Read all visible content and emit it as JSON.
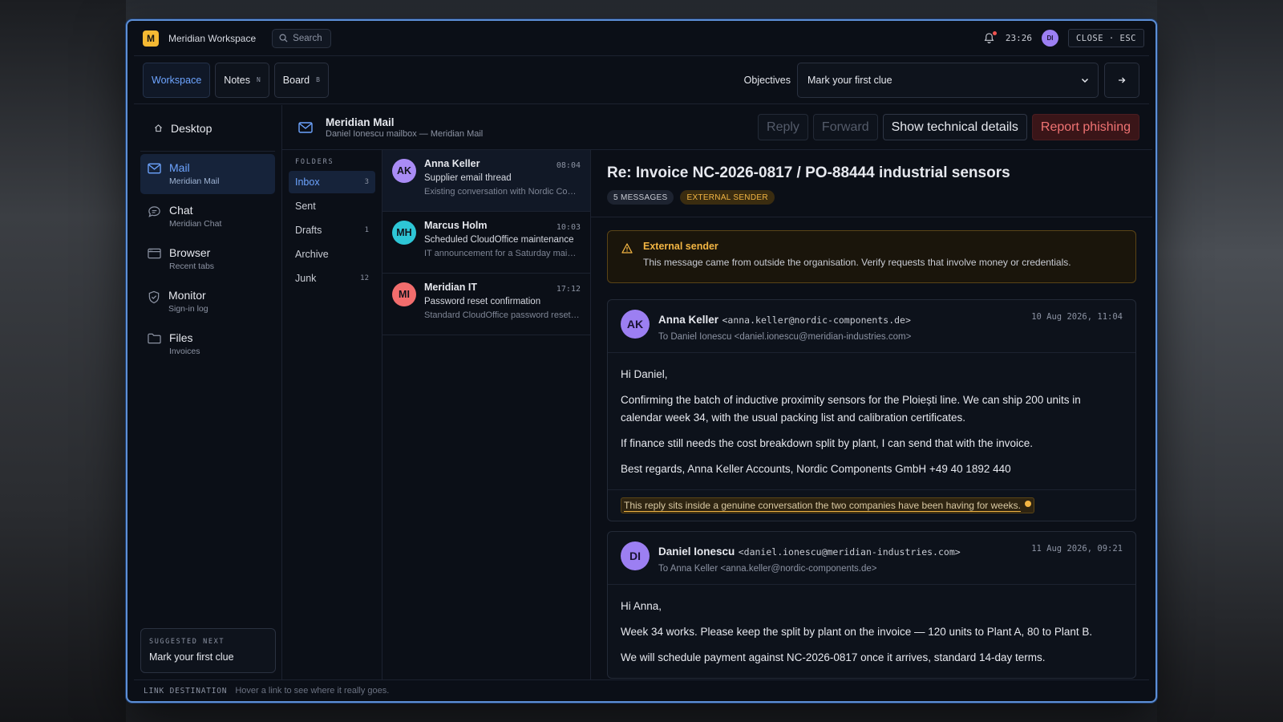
{
  "app": {
    "logo_letter": "M",
    "title": "Meridian Workspace",
    "search_label": "Search",
    "time": "23:26",
    "user_initials": "DI",
    "close_label": "CLOSE · ESC"
  },
  "tabs": [
    {
      "label": "Workspace",
      "key": ""
    },
    {
      "label": "Notes",
      "key": "N"
    },
    {
      "label": "Board",
      "key": "B"
    }
  ],
  "objectives": {
    "label": "Objectives",
    "selected": "Mark your first clue"
  },
  "sidebar": {
    "desktop_label": "Desktop",
    "items": [
      {
        "title": "Mail",
        "sub": "Meridian Mail",
        "icon": "mail-icon"
      },
      {
        "title": "Chat",
        "sub": "Meridian Chat",
        "icon": "chat-icon"
      },
      {
        "title": "Browser",
        "sub": "Recent tabs",
        "icon": "browser-icon"
      },
      {
        "title": "Monitor",
        "sub": "Sign-in log",
        "icon": "shield-icon"
      },
      {
        "title": "Files",
        "sub": "Invoices",
        "icon": "folder-icon"
      }
    ],
    "suggested_label": "SUGGESTED NEXT",
    "suggested_value": "Mark your first clue"
  },
  "mail": {
    "app_title": "Meridian Mail",
    "mailbox": "Daniel Ionescu mailbox — Meridian Mail",
    "actions": {
      "reply": "Reply",
      "forward": "Forward",
      "details": "Show technical details",
      "report": "Report phishing"
    },
    "folders_header": "FOLDERS",
    "folders": [
      {
        "name": "Inbox",
        "count": "3"
      },
      {
        "name": "Sent",
        "count": ""
      },
      {
        "name": "Drafts",
        "count": "1"
      },
      {
        "name": "Archive",
        "count": ""
      },
      {
        "name": "Junk",
        "count": "12"
      }
    ],
    "messages": [
      {
        "initials": "AK",
        "from": "Anna Keller",
        "time": "08:04",
        "subject": "Supplier email thread",
        "preview": "Existing conversation with Nordic Components",
        "color": "#a98cf5"
      },
      {
        "initials": "MH",
        "from": "Marcus Holm",
        "time": "10:03",
        "subject": "Scheduled CloudOffice maintenance",
        "preview": "IT announcement for a Saturday maintenance window",
        "color": "#2ec6d6"
      },
      {
        "initials": "MI",
        "from": "Meridian IT",
        "time": "17:12",
        "subject": "Password reset confirmation",
        "preview": "Standard CloudOffice password reset notice",
        "color": "#f26d6d"
      }
    ]
  },
  "reader": {
    "subject": "Re: Invoice NC-2026-0817 / PO-88444 industrial sensors",
    "badge_count": "5 MESSAGES",
    "badge_external": "EXTERNAL SENDER",
    "warning_title": "External sender",
    "warning_text": "This message came from outside the organisation. Verify requests that involve money or credentials.",
    "thread": [
      {
        "initials": "AK",
        "from_name": "Anna Keller",
        "from_email": "<anna.keller@nordic-components.de>",
        "to": "To Daniel Ionescu <daniel.ionescu@meridian-industries.com>",
        "date": "10 Aug 2026, 11:04",
        "paragraphs": [
          "Hi Daniel,",
          "Confirming the batch of inductive proximity sensors for the Ploiești line. We can ship 200 units in calendar week 34, with the usual packing list and calibration certificates.",
          "If finance still needs the cost breakdown split by plant, I can send that with the invoice.",
          "Best regards, Anna Keller Accounts, Nordic Components GmbH +49 40 1892 440"
        ],
        "clue": "This reply sits inside a genuine conversation the two companies have been having for weeks."
      },
      {
        "initials": "DI",
        "from_name": "Daniel Ionescu",
        "from_email": "<daniel.ionescu@meridian-industries.com>",
        "to": "To Anna Keller <anna.keller@nordic-components.de>",
        "date": "11 Aug 2026, 09:21",
        "paragraphs": [
          "Hi Anna,",
          "Week 34 works. Please keep the split by plant on the invoice — 120 units to Plant A, 80 to Plant B.",
          "We will schedule payment against NC-2026-0817 once it arrives, standard 14-day terms."
        ]
      }
    ]
  },
  "statusbar": {
    "label": "LINK DESTINATION",
    "value": "Hover a link to see where it really goes."
  }
}
